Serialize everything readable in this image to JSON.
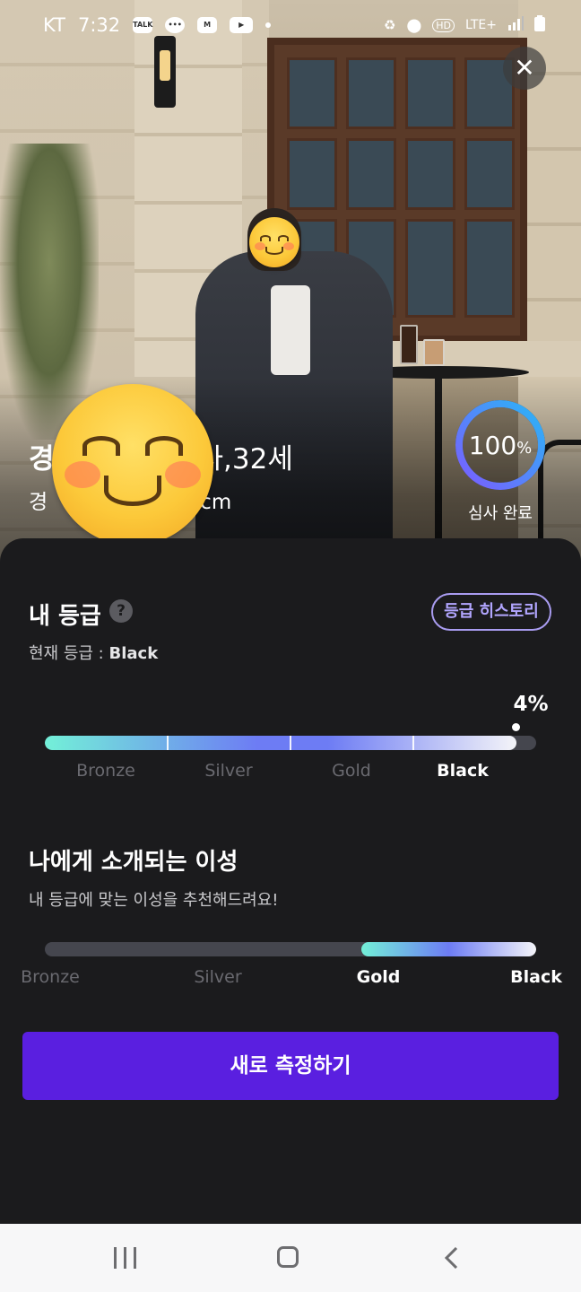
{
  "status_bar": {
    "carrier": "KT",
    "time": "7:32",
    "app_icons": [
      "talk-icon",
      "chat-icon",
      "m-icon",
      "youtube-icon"
    ],
    "right_icons": [
      "recycle-icon",
      "location-icon",
      "hd-icon",
      "signal-icon",
      "battery-icon"
    ],
    "hd_text": "HD",
    "network": "LTE+"
  },
  "profile": {
    "name_first_char": "경",
    "name_visible_tail": "사,",
    "age": "32세",
    "sub_first_char": "경",
    "sub_visible_tail": "cm",
    "review_percent": "100",
    "review_percent_unit": "%",
    "review_progress": 1.0,
    "review_caption": "심사 완료"
  },
  "grade": {
    "title": "내 등급",
    "help_glyph": "?",
    "history_button": "등급 히스토리",
    "current_prefix": "현재 등급 : ",
    "current_value": "Black",
    "percent": "4%",
    "tiers": [
      "Bronze",
      "Silver",
      "Gold",
      "Black"
    ],
    "active_tier": "Black"
  },
  "introductions": {
    "title": "나에게 소개되는 이성",
    "subtitle": "내 등급에 맞는 이성을 추천해드려요!",
    "tiers": [
      "Bronze",
      "Silver",
      "Gold",
      "Black"
    ],
    "active_tiers": [
      "Gold",
      "Black"
    ],
    "range_start_fraction": 0.645,
    "range_end_fraction": 1.0
  },
  "cta": {
    "label": "새로 측정하기"
  },
  "colors": {
    "accent": "#5a1fe0",
    "history_border": "#a99cf0",
    "ring_start": "#7b5cff",
    "ring_end": "#29b6f6",
    "bar_start": "#73f0d8",
    "bar_mid": "#6d7cf4",
    "bar_end": "#f4f4f8"
  }
}
